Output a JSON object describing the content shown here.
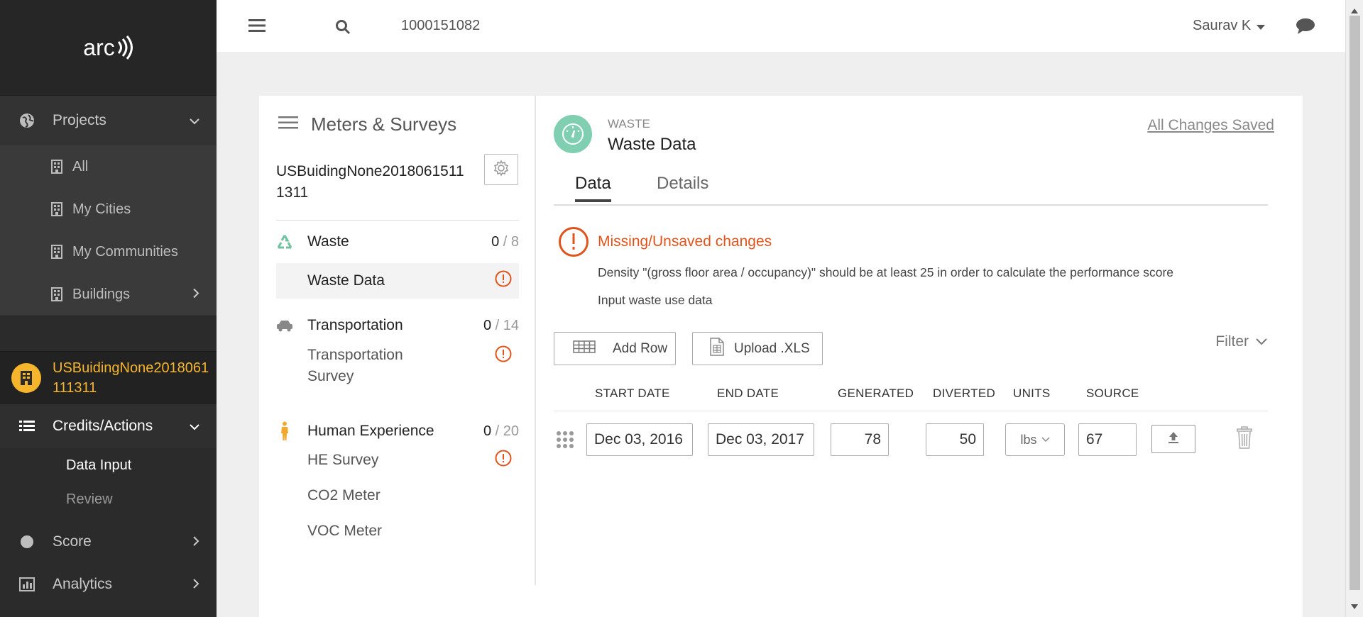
{
  "app": {
    "logo_text": "arc"
  },
  "sidebar": {
    "projects_label": "Projects",
    "project_items": [
      {
        "label": "All"
      },
      {
        "label": "My Cities"
      },
      {
        "label": "My Communities"
      },
      {
        "label": "Buildings"
      }
    ],
    "active_project": {
      "line1": "USBuidingNone2018061",
      "line2": "111311"
    },
    "credits_label": "Credits/Actions",
    "credits_items": [
      {
        "label": "Data Input",
        "active": true
      },
      {
        "label": "Review",
        "active": false
      }
    ],
    "score_label": "Score",
    "analytics_label": "Analytics"
  },
  "topbar": {
    "search_value": "1000151082",
    "user_name": "Saurav K"
  },
  "left_panel": {
    "title": "Meters & Surveys",
    "project_name": "USBuidingNone20180615111311",
    "categories": [
      {
        "name": "Waste",
        "count": "0",
        "total": " / 8",
        "items": [
          "Waste Data"
        ]
      },
      {
        "name": "Transportation",
        "count": "0",
        "total": " / 14",
        "items": [
          "Transportation Survey"
        ]
      },
      {
        "name": "Human Experience",
        "count": "0",
        "total": " / 20",
        "items": [
          "HE Survey",
          "CO2 Meter",
          "VOC Meter"
        ]
      }
    ]
  },
  "meter": {
    "category": "WASTE",
    "title": "Waste Data",
    "saved_status": "All Changes Saved",
    "tabs": [
      {
        "label": "Data"
      },
      {
        "label": "Details"
      }
    ],
    "alert": {
      "title": "Missing/Unsaved changes",
      "messages": [
        "Density \"(gross floor area / occupancy)\" should be at least 25 in order to calculate the performance score",
        "Input waste use data"
      ]
    },
    "buttons": {
      "add_row": "Add Row",
      "upload": "Upload .XLS",
      "filter": "Filter"
    },
    "columns": [
      "START DATE",
      "END DATE",
      "GENERATED",
      "DIVERTED",
      "UNITS",
      "SOURCE"
    ],
    "rows": [
      {
        "start_date": "Dec 03, 2016",
        "end_date": "Dec 03, 2017",
        "generated": "78",
        "diverted": "50",
        "units": "lbs",
        "source": "67"
      }
    ]
  },
  "colors": {
    "accent_orange": "#e0541c",
    "project_yellow": "#f7b52b",
    "waste_green": "#7fcfb0"
  }
}
